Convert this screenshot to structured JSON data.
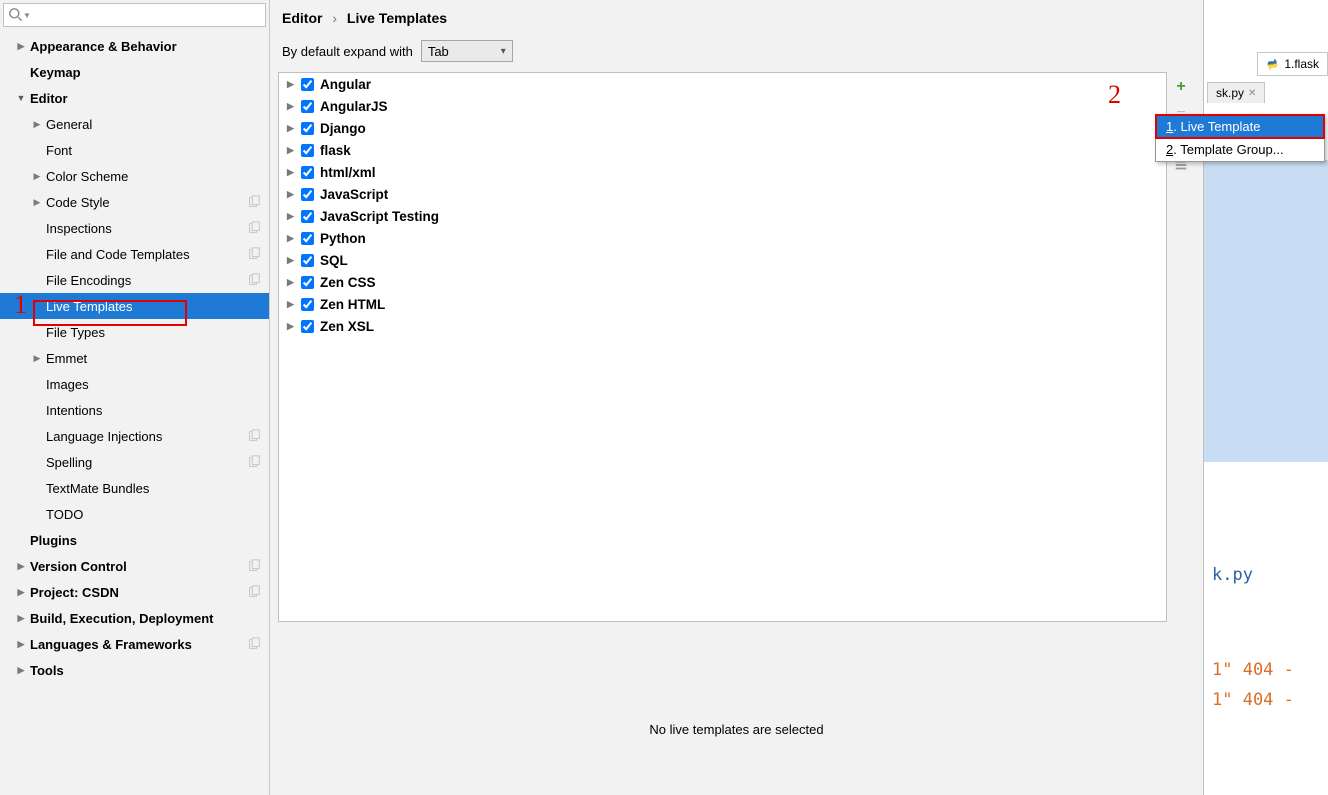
{
  "breadcrumb": {
    "part1": "Editor",
    "part2": "Live Templates"
  },
  "expand": {
    "label": "By default expand with",
    "value": "Tab"
  },
  "search": {
    "placeholder": ""
  },
  "sidebar": [
    {
      "label": "Appearance & Behavior",
      "indent": 0,
      "bold": true,
      "arrow": "closed"
    },
    {
      "label": "Keymap",
      "indent": 0,
      "bold": true,
      "arrow": "none"
    },
    {
      "label": "Editor",
      "indent": 0,
      "bold": true,
      "arrow": "open"
    },
    {
      "label": "General",
      "indent": 1,
      "bold": false,
      "arrow": "closed"
    },
    {
      "label": "Font",
      "indent": 1,
      "bold": false,
      "arrow": "none"
    },
    {
      "label": "Color Scheme",
      "indent": 1,
      "bold": false,
      "arrow": "closed"
    },
    {
      "label": "Code Style",
      "indent": 1,
      "bold": false,
      "arrow": "closed",
      "copy": true
    },
    {
      "label": "Inspections",
      "indent": 1,
      "bold": false,
      "arrow": "none",
      "copy": true
    },
    {
      "label": "File and Code Templates",
      "indent": 1,
      "bold": false,
      "arrow": "none",
      "copy": true
    },
    {
      "label": "File Encodings",
      "indent": 1,
      "bold": false,
      "arrow": "none",
      "copy": true
    },
    {
      "label": "Live Templates",
      "indent": 1,
      "bold": false,
      "arrow": "none",
      "selected": true
    },
    {
      "label": "File Types",
      "indent": 1,
      "bold": false,
      "arrow": "none"
    },
    {
      "label": "Emmet",
      "indent": 1,
      "bold": false,
      "arrow": "closed"
    },
    {
      "label": "Images",
      "indent": 1,
      "bold": false,
      "arrow": "none"
    },
    {
      "label": "Intentions",
      "indent": 1,
      "bold": false,
      "arrow": "none"
    },
    {
      "label": "Language Injections",
      "indent": 1,
      "bold": false,
      "arrow": "none",
      "copy": true
    },
    {
      "label": "Spelling",
      "indent": 1,
      "bold": false,
      "arrow": "none",
      "copy": true
    },
    {
      "label": "TextMate Bundles",
      "indent": 1,
      "bold": false,
      "arrow": "none"
    },
    {
      "label": "TODO",
      "indent": 1,
      "bold": false,
      "arrow": "none"
    },
    {
      "label": "Plugins",
      "indent": 0,
      "bold": true,
      "arrow": "none"
    },
    {
      "label": "Version Control",
      "indent": 0,
      "bold": true,
      "arrow": "closed",
      "copy": true
    },
    {
      "label": "Project: CSDN",
      "indent": 0,
      "bold": true,
      "arrow": "closed",
      "copy": true
    },
    {
      "label": "Build, Execution, Deployment",
      "indent": 0,
      "bold": true,
      "arrow": "closed"
    },
    {
      "label": "Languages & Frameworks",
      "indent": 0,
      "bold": true,
      "arrow": "closed",
      "copy": true
    },
    {
      "label": "Tools",
      "indent": 0,
      "bold": true,
      "arrow": "closed"
    }
  ],
  "templates": [
    "Angular",
    "AngularJS",
    "Django",
    "flask",
    "html/xml",
    "JavaScript",
    "JavaScript Testing",
    "Python",
    "SQL",
    "Zen CSS",
    "Zen HTML",
    "Zen XSL"
  ],
  "status": "No live templates are selected",
  "popup": {
    "item1": "Live Template",
    "item2": "Template Group..."
  },
  "bg": {
    "tab": "sk.py",
    "filetab": "1.flask",
    "code_py": "k.py",
    "code_l1": "1\" 404 -",
    "code_l2": "1\" 404 -"
  },
  "anno": {
    "n1": "1",
    "n2": "2"
  }
}
